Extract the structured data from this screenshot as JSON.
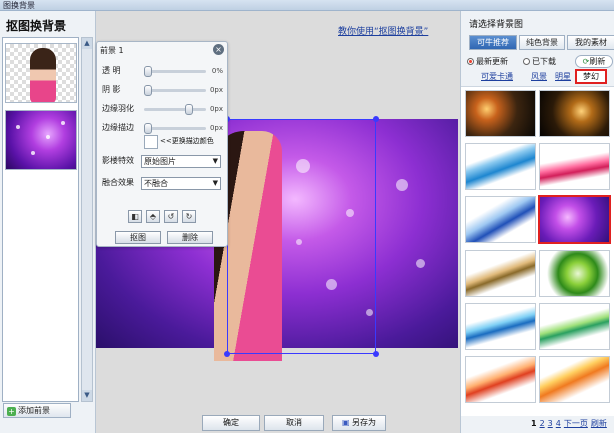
{
  "window": {
    "title": "图换背景"
  },
  "left": {
    "title": "抠图换背景",
    "add_label": "添加前景"
  },
  "center": {
    "help_link": "教你使用“抠图换背景”",
    "buttons": {
      "ok": "确定",
      "cancel": "取消",
      "save_as": "另存为"
    }
  },
  "panel": {
    "header": "前景 1",
    "rows": [
      {
        "label": "透    明",
        "value": "0%",
        "level": 0.0
      },
      {
        "label": "阴    影",
        "value": "0px",
        "level": 0.0
      },
      {
        "label": "边缘羽化",
        "value": "0px",
        "level": 0.75
      },
      {
        "label": "边缘描边",
        "value": "0px",
        "level": 0.0
      }
    ],
    "color_label": "<<更换描边颜色",
    "effect_label": "影楼特效",
    "effect_value": "原始图片",
    "blend_label": "融合效果",
    "blend_value": "不融合",
    "cutout_button": "抠图",
    "delete_button": "删除"
  },
  "right": {
    "title": "请选择背景图",
    "tabs": [
      "可牛推荐",
      "纯色背景",
      "我的素材"
    ],
    "active_tab": 0,
    "radios": [
      "最新更新",
      "已下载"
    ],
    "refresh_label": "刷新",
    "categories": [
      "可爱卡通",
      "风景",
      "明星",
      "梦幻"
    ],
    "selected_category": 3,
    "pager": {
      "pages": [
        "1",
        "2",
        "3",
        "4"
      ],
      "next": "下一页",
      "refresh": "刷新"
    }
  },
  "colors": {
    "accent": "#2f66b3",
    "highlight": "#e02020",
    "link": "#1d3f9e"
  }
}
